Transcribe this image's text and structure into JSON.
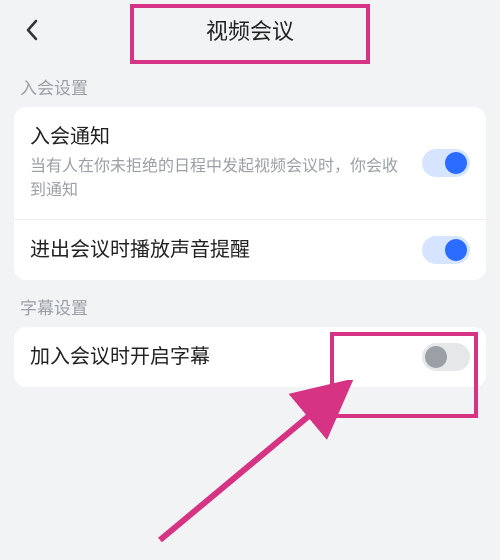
{
  "header": {
    "title": "视频会议"
  },
  "sections": {
    "join": {
      "label": "入会设置",
      "row1": {
        "title": "入会通知",
        "subtitle": "当有人在你未拒绝的日程中发起视频会议时，你会收到通知",
        "on": true
      },
      "row2": {
        "title": "进出会议时播放声音提醒",
        "on": true
      }
    },
    "subs": {
      "label": "字幕设置",
      "row1": {
        "title": "加入会议时开启字幕",
        "on": false
      }
    }
  },
  "colors": {
    "accent": "#2b6bff",
    "annotation": "#d63384"
  }
}
